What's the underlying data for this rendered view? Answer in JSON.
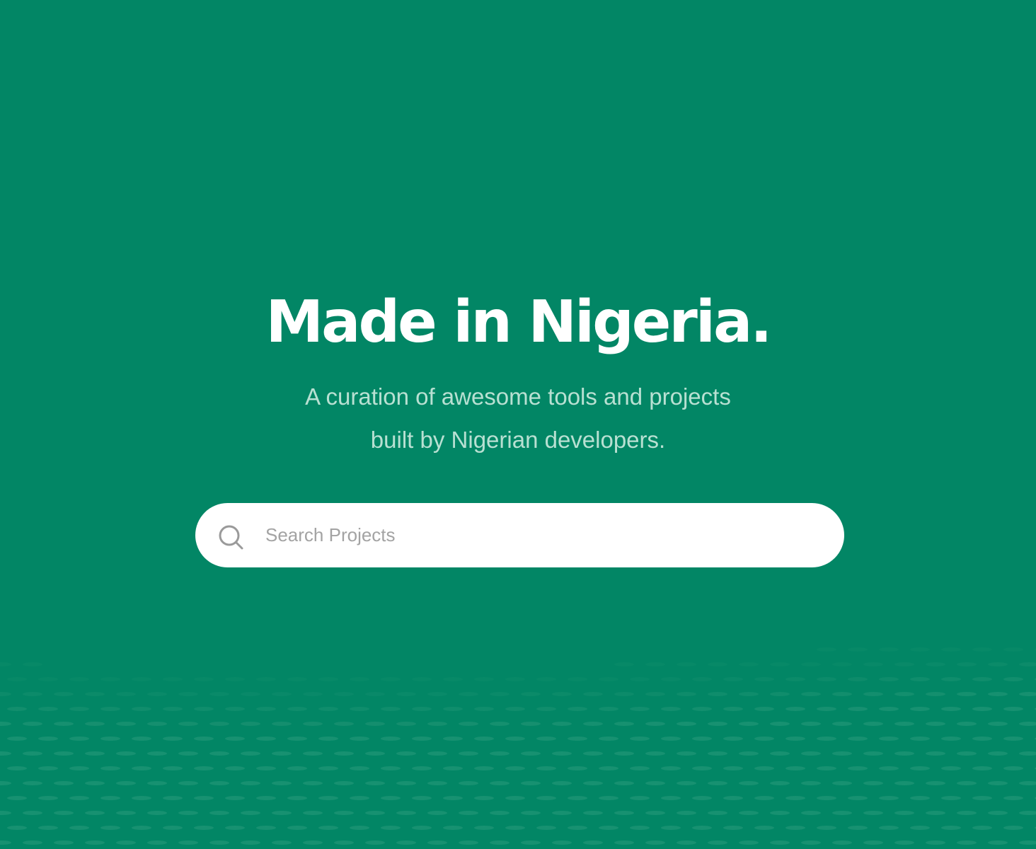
{
  "hero": {
    "title": "Made in Nigeria.",
    "subtitle_line1": "A curation of awesome tools and projects",
    "subtitle_line2": "built by Nigerian developers."
  },
  "search": {
    "placeholder": "Search Projects",
    "icon": "search-icon"
  },
  "colors": {
    "background": "#028665",
    "title": "#ffffff",
    "subtitle": "#b8e0d2",
    "search_bg": "#ffffff",
    "placeholder": "#a3a3a3",
    "pattern": "#2a9a7b"
  }
}
